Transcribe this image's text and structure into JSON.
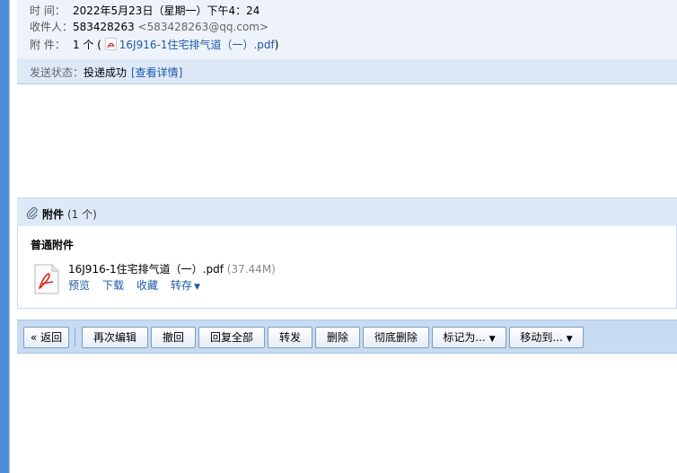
{
  "header": {
    "time_label": "时  间：",
    "time_value": "2022年5月23日（星期一）下午4：24",
    "recipient_label": "收件人：",
    "recipient_name": "583428263",
    "recipient_email": "<583428263@qq.com>",
    "attach_label": "附  件：",
    "attach_count": "1 个 (",
    "attach_file": "16J916-1住宅排气道（一）.pdf",
    "attach_close": ")"
  },
  "status": {
    "label": "发送状态：",
    "value": "投递成功",
    "detail_link": "[查看详情]"
  },
  "attachments": {
    "title": "附件",
    "count": "(1 个)",
    "section_label": "普通附件",
    "file_name": "16J916-1住宅排气道（一）.pdf",
    "file_size": "(37.44M)",
    "actions": {
      "preview": "预览",
      "download": "下载",
      "favorite": "收藏",
      "save_to": "转存"
    }
  },
  "toolbar": {
    "back": "« 返回",
    "edit_again": "再次编辑",
    "recall": "撤回",
    "reply_all": "回复全部",
    "forward": "转发",
    "delete": "删除",
    "delete_permanently": "彻底删除",
    "mark_as": "标记为...",
    "move_to": "移动到..."
  },
  "colors": {
    "accent": "#1d5aa7",
    "toolbar_bg": "#c7dbf3",
    "panel_bg": "#dde9f7",
    "pdf_red": "#d7281e"
  },
  "icons": {
    "pdf": "pdf-icon",
    "paperclip": "paperclip-icon",
    "caret": "caret-down-icon"
  }
}
